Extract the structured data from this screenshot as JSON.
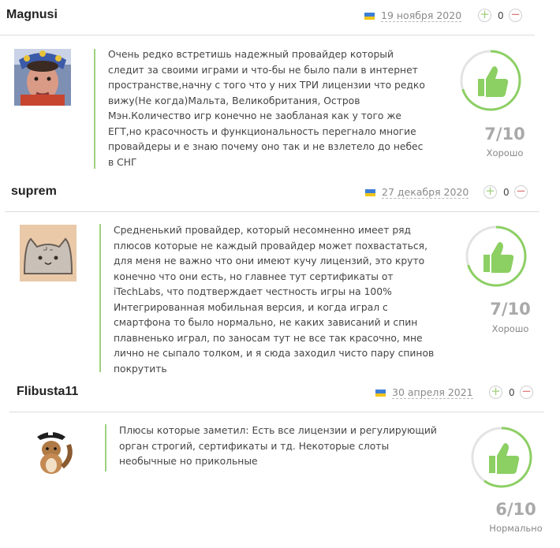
{
  "reviews": [
    {
      "username": "Magnusi",
      "date": "19 ноября 2020",
      "votes": "0",
      "text": "Очень редко встретишь надежный провайдер который следит за своими играми и что-бы не было пали в интернет пространстве,начну с того что у них ТРИ лицензии что редко вижу(Не когда)Мальта, Великобритания, Остров Мэн.Количество игр конечно не заобланая как у того же ЕГТ,но красочность и функциональность перегнало многие провайдеры и е знаю почему оно так и не взлетело до небес в СНГ",
      "score": "7/10",
      "score_value": 7,
      "rating_label": "Хорошо",
      "avatar": "photo-face-icon"
    },
    {
      "username": "suprem",
      "date": "27 декабря 2020",
      "votes": "0",
      "text": "Средненький провайдер, который несомненно имеет ряд плюсов которые не каждый провайдер может похвастаться, для меня не важно что они имеют кучу лицензий, это круто конечно что они есть, но главнее тут сертификаты от iTechLabs, что подтверждает честность игры на 100% Интегрированная мобильная версия, и когда играл с смартфона то было нормально, не каких зависаний и спин плавненько играл, по заносам тут не все так красочно, мне лично не сыпало толком, и я сюда заходил чисто пару спинов покрутить",
      "score": "7/10",
      "score_value": 7,
      "rating_label": "Хорошо",
      "avatar": "cat-icon"
    },
    {
      "username": "Flibusta11",
      "date": "30 апреля 2021",
      "votes": "0",
      "text": "Плюсы которые заметил: Есть все лицензии и регулирующий орган строгий, сертификаты и тд. Некоторые слоты необычные но прикольные",
      "score": "6/10",
      "score_value": 6,
      "rating_label": "Нормально",
      "avatar": "chipmunk-pirate-icon"
    }
  ],
  "colors": {
    "accent": "#8ccf63",
    "divider_line": "#9fd17f",
    "score": "#a9a9a9",
    "flag_blue": "#3d7fd6",
    "flag_yellow": "#f2c618"
  }
}
